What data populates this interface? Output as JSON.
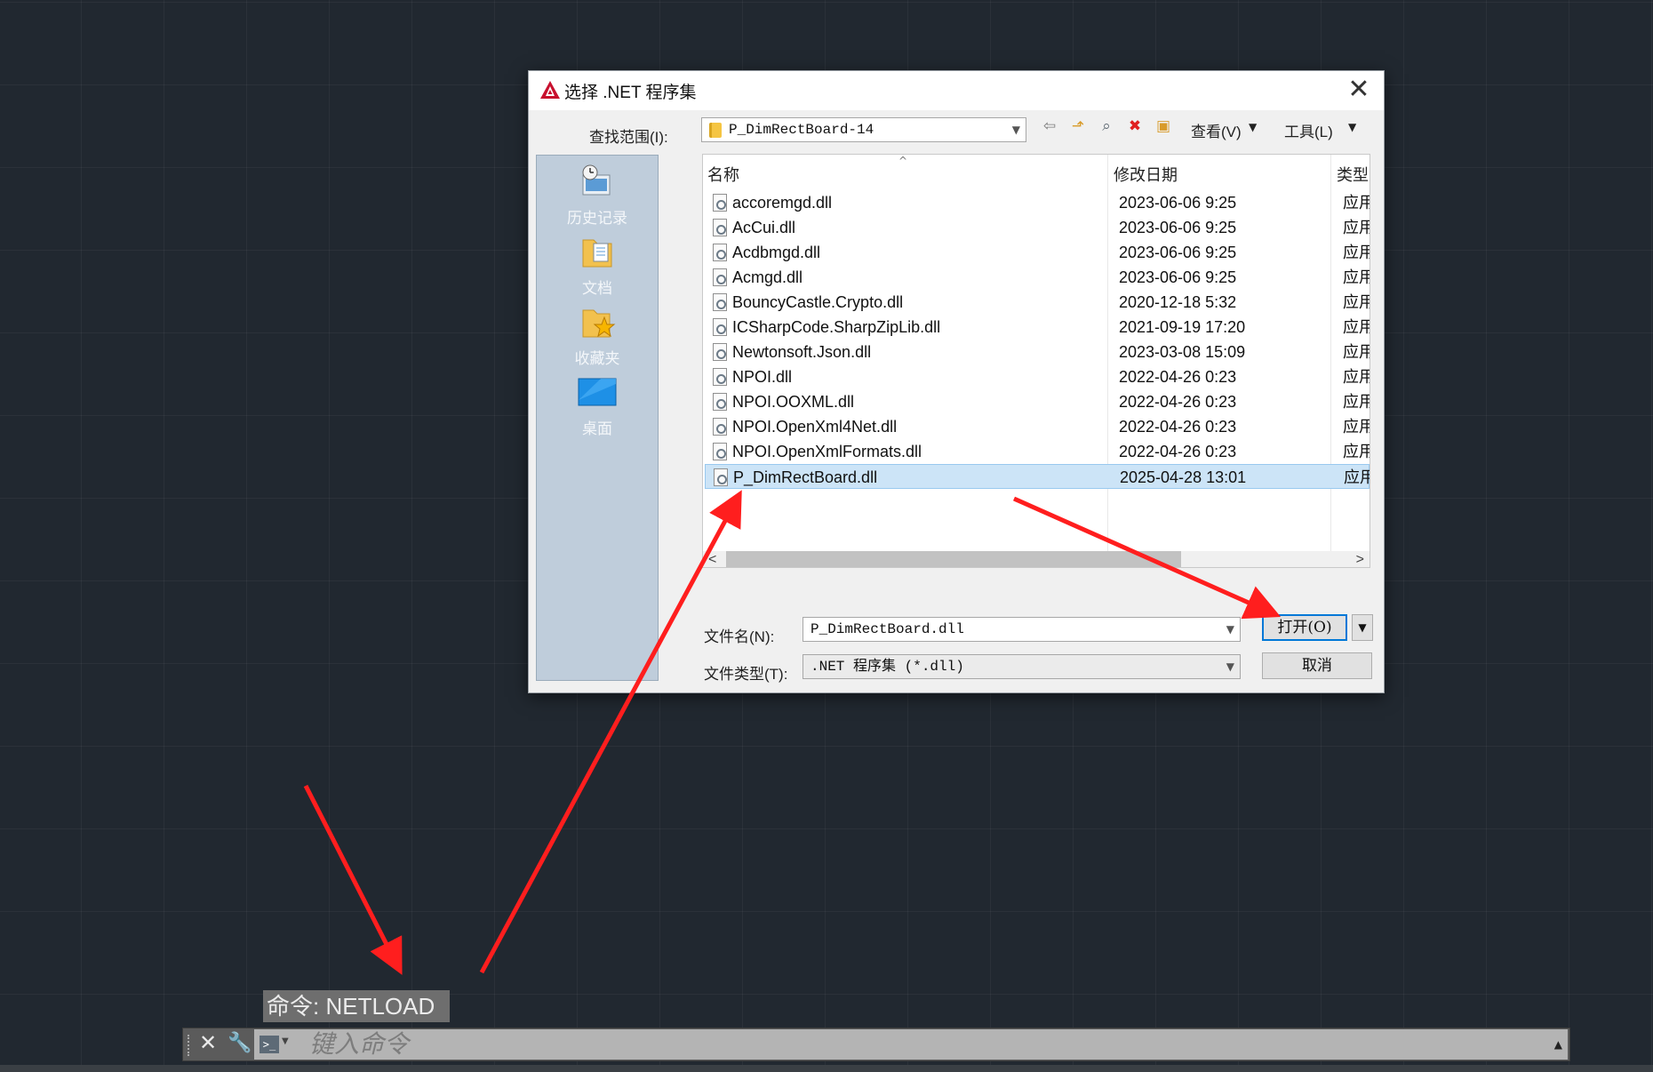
{
  "dialog": {
    "title": "选择 .NET 程序集",
    "close_glyph": "✕",
    "look_in_label": "查找范围(I):",
    "look_in_value": "P_DimRectBoard-14",
    "view_label": "查看(V)",
    "tools_label": "工具(L)",
    "places": [
      {
        "label": "历史记录",
        "icon": "history-icon"
      },
      {
        "label": "文档",
        "icon": "documents-icon"
      },
      {
        "label": "收藏夹",
        "icon": "favorites-icon"
      },
      {
        "label": "桌面",
        "icon": "desktop-icon"
      }
    ],
    "columns": {
      "name": "名称",
      "date": "修改日期",
      "type": "类型"
    },
    "files": [
      {
        "name": "accoremgd.dll",
        "date": "2023-06-06 9:25",
        "type": "应用程序扩展"
      },
      {
        "name": "AcCui.dll",
        "date": "2023-06-06 9:25",
        "type": "应用程序扩展"
      },
      {
        "name": "Acdbmgd.dll",
        "date": "2023-06-06 9:25",
        "type": "应用程序扩展"
      },
      {
        "name": "Acmgd.dll",
        "date": "2023-06-06 9:25",
        "type": "应用程序扩展"
      },
      {
        "name": "BouncyCastle.Crypto.dll",
        "date": "2020-12-18 5:32",
        "type": "应用程序扩展"
      },
      {
        "name": "ICSharpCode.SharpZipLib.dll",
        "date": "2021-09-19 17:20",
        "type": "应用程序扩展"
      },
      {
        "name": "Newtonsoft.Json.dll",
        "date": "2023-03-08 15:09",
        "type": "应用程序扩展"
      },
      {
        "name": "NPOI.dll",
        "date": "2022-04-26 0:23",
        "type": "应用程序扩展"
      },
      {
        "name": "NPOI.OOXML.dll",
        "date": "2022-04-26 0:23",
        "type": "应用程序扩展"
      },
      {
        "name": "NPOI.OpenXml4Net.dll",
        "date": "2022-04-26 0:23",
        "type": "应用程序扩展"
      },
      {
        "name": "NPOI.OpenXmlFormats.dll",
        "date": "2022-04-26 0:23",
        "type": "应用程序扩展"
      },
      {
        "name": "P_DimRectBoard.dll",
        "date": "2025-04-28 13:01",
        "type": "应用程序扩展",
        "selected": true
      }
    ],
    "filename_label": "文件名(N):",
    "filename_value": "P_DimRectBoard.dll",
    "filetype_label": "文件类型(T):",
    "filetype_value": ".NET 程序集 (*.dll)",
    "open_label": "打开(O)",
    "cancel_label": "取消"
  },
  "command_line": {
    "history": "命令: NETLOAD",
    "placeholder": "键入命令"
  },
  "colors": {
    "canvas_bg": "#212830",
    "selection": "#cce4f7",
    "annotation_arrow": "#ff1e1e"
  }
}
